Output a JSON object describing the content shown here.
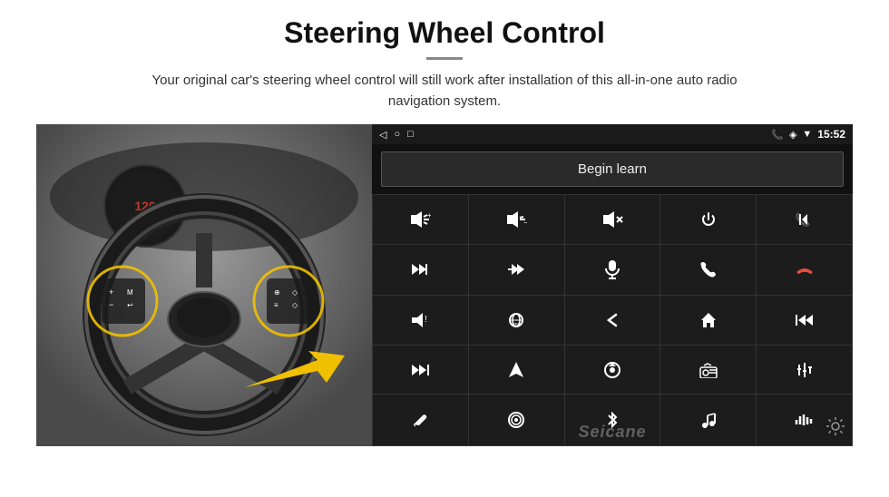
{
  "header": {
    "title": "Steering Wheel Control",
    "divider": true,
    "subtitle": "Your original car's steering wheel control will still work after installation of this all-in-one auto radio navigation system."
  },
  "android_screen": {
    "status_bar": {
      "nav_back": "◁",
      "nav_home": "○",
      "nav_square": "□",
      "battery_icon": "▮▮",
      "phone_icon": "📞",
      "location_icon": "◈",
      "wifi_icon": "▼",
      "time": "15:52"
    },
    "begin_learn_label": "Begin learn",
    "buttons": [
      {
        "icon": "🔊+",
        "label": "vol-up"
      },
      {
        "icon": "🔊-",
        "label": "vol-down"
      },
      {
        "icon": "🔇",
        "label": "mute"
      },
      {
        "icon": "⏻",
        "label": "power"
      },
      {
        "icon": "⏮",
        "label": "prev-skip"
      },
      {
        "icon": "⏭",
        "label": "next"
      },
      {
        "icon": "⏭",
        "label": "fast-forward"
      },
      {
        "icon": "🎤",
        "label": "mic"
      },
      {
        "icon": "📞",
        "label": "call"
      },
      {
        "icon": "↩",
        "label": "hang-up"
      },
      {
        "icon": "📢",
        "label": "horn"
      },
      {
        "icon": "360°",
        "label": "cam-360"
      },
      {
        "icon": "↺",
        "label": "back"
      },
      {
        "icon": "⌂",
        "label": "home"
      },
      {
        "icon": "⏮⏮",
        "label": "rewind"
      },
      {
        "icon": "⏭⏭",
        "label": "ff"
      },
      {
        "icon": "▶",
        "label": "nav"
      },
      {
        "icon": "⏏",
        "label": "source"
      },
      {
        "icon": "📻",
        "label": "radio"
      },
      {
        "icon": "⚙",
        "label": "settings-eq"
      },
      {
        "icon": "✏",
        "label": "edit"
      },
      {
        "icon": "⊙",
        "label": "menu"
      },
      {
        "icon": "✱",
        "label": "bluetooth"
      },
      {
        "icon": "🎵",
        "label": "music"
      },
      {
        "icon": "|||",
        "label": "equalizer"
      }
    ],
    "watermark": "Seicane",
    "gear_icon": "⚙"
  }
}
